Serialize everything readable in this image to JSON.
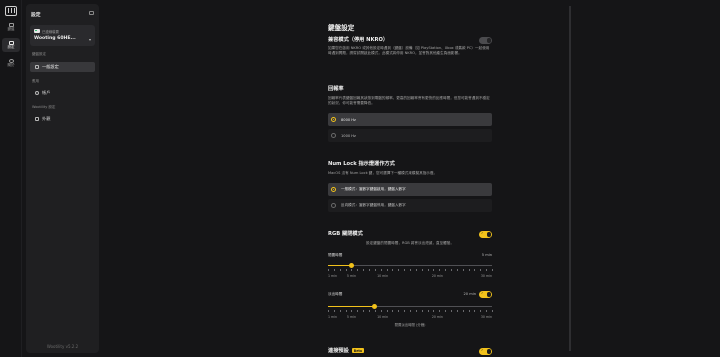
{
  "rail": {
    "items": [
      {
        "label": "鍵盤"
      },
      {
        "label": "設定"
      },
      {
        "label": "關於"
      }
    ]
  },
  "sidebar": {
    "title": "設定",
    "device": {
      "line1": "已連線裝置",
      "name": "Wooting 60HE..."
    },
    "sections": [
      {
        "label": "鍵盤設定",
        "items": [
          "一般設定"
        ]
      },
      {
        "label": "應用",
        "items": [
          "帳戶"
        ]
      },
      {
        "label": "Wootility 設定",
        "items": [
          "外觀"
        ]
      }
    ],
    "version": "Wootility v5.2.2"
  },
  "main": {
    "title": "鍵盤設定",
    "nkro": {
      "title": "兼容模式（停用 NKRO）",
      "desc": "如果您在啟用 NKRO 或其他設定時遇到（鍵盤）設備（如 PlayStation、Xbox 或舊款 PC）一起使用時遇到問題，請嘗試開啟此模式，此模式將停用 NKRO，並會對其他產生負面影響。",
      "enabled": false
    },
    "polling": {
      "title": "回報率",
      "desc": "回報率代表鍵盤回報其狀態到電腦的頻率。更高的回報率會有更快的反應時間，但您可能會遇到不穩定的狀況，你可能會需要降低。",
      "options": [
        "8000 Hz",
        "1000 Hz"
      ],
      "selected": 0
    },
    "numlock": {
      "title": "Num Lock 指示燈運作方式",
      "desc": "MacOS 沒有 Num Lock 鍵，您可選擇下一種模式來模擬其指示燈。",
      "options": [
        "一般模式：當數字鍵盤啟用，鍵盤入數字",
        "反向模式：當數字鍵盤停用，鍵盤入數字"
      ],
      "selected": 0
    },
    "rgb": {
      "title": "RGB 關閉模式",
      "desc": "設定鍵盤的閒置時間，RGB 將會淡出熄滅，直至觸發。",
      "enabled": true,
      "slider1": {
        "label": "閒置時間",
        "value": "5 min",
        "progress": 0.143
      },
      "slider2": {
        "label": "淡出時間",
        "value": "20 min",
        "progress": 0.286,
        "enabled": true
      },
      "ticks": [
        "1 min",
        "5 min",
        "10 min",
        "20 min",
        "30 min"
      ],
      "tick_positions": [
        0.0,
        0.143,
        0.333,
        0.667,
        1.0
      ],
      "note": "閒置淡出時間 (分鐘)"
    },
    "bottom": {
      "title": "連接預設",
      "badge": "Beta"
    }
  },
  "colors": {
    "accent": "#f2c21b",
    "bg": "#151517",
    "panel": "#1f1f21"
  }
}
